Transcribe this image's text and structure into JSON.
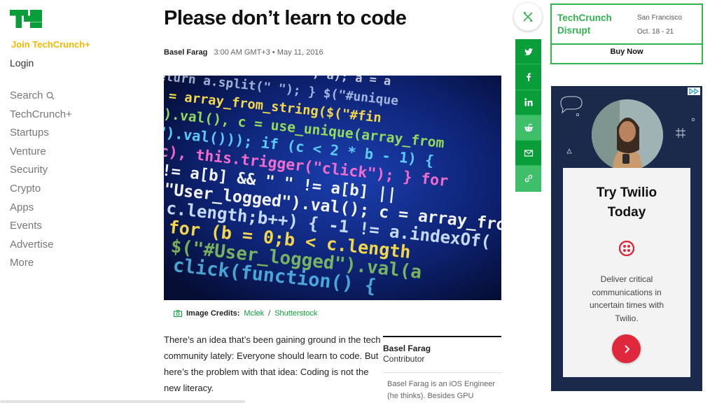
{
  "sidebar": {
    "join_label": "Join TechCrunch+",
    "login_label": "Login",
    "search_label": "Search",
    "nav_items": [
      "TechCrunch+",
      "Startups",
      "Venture",
      "Security",
      "Crypto",
      "Apps",
      "Events",
      "Advertise",
      "More"
    ]
  },
  "article": {
    "title": "Please don’t learn to code",
    "author": "Basel Farag",
    "timestamp": "3:00 AM GMT+3 • May 11, 2016",
    "credits_label": "Image Credits:",
    "credit_1": "Mclek",
    "credit_sep": "/",
    "credit_2": "Shutterstock",
    "paragraph": "There’s an idea that’s been gaining ground in the tech community lately: Everyone should learn to code. But here’s the problem with that idea: Coding is not the new literacy."
  },
  "author_box": {
    "name": "Basel Farag",
    "role": "Contributor",
    "bio": "Basel Farag is an iOS Engineer (he thinks). Besides GPU processors, robots and AI"
  },
  "share": {
    "icons": [
      "twitter-icon",
      "facebook-icon",
      "linkedin-icon",
      "reddit-icon",
      "email-icon",
      "link-icon"
    ]
  },
  "promo": {
    "brand_line1": "TechCrunch",
    "brand_line2": "Disrupt",
    "city": "San Francisco",
    "dates": "Oct. 18 - 21",
    "buy_label": "Buy Now"
  },
  "ad": {
    "headline": "Try Twilio Today",
    "description": "Deliver critical communications in uncertain times with Twilio.",
    "accent": "#e0283c"
  },
  "hero_code": [
    ") = replaceAll(\",\", \" \", a); a = a",
    "return a.split(\" \"); } $(\"#unique",
    "a = array_from_string($(\"#fin",
    "\").val(), c = use_unique(array_from",
    "\").val())); if (c < 2 * b - 1) {",
    "c), this.trigger(\"click\"); } for",
    "!= a[b] && \" \" != a[b] ||",
    "\"User_logged\").val(); c = array_from",
    "c.length;b++) { -1 != a.indexOf(",
    "for (b = 0;b < c.length",
    "$(\"#User_logged\").val(a",
    "click(function() {"
  ]
}
